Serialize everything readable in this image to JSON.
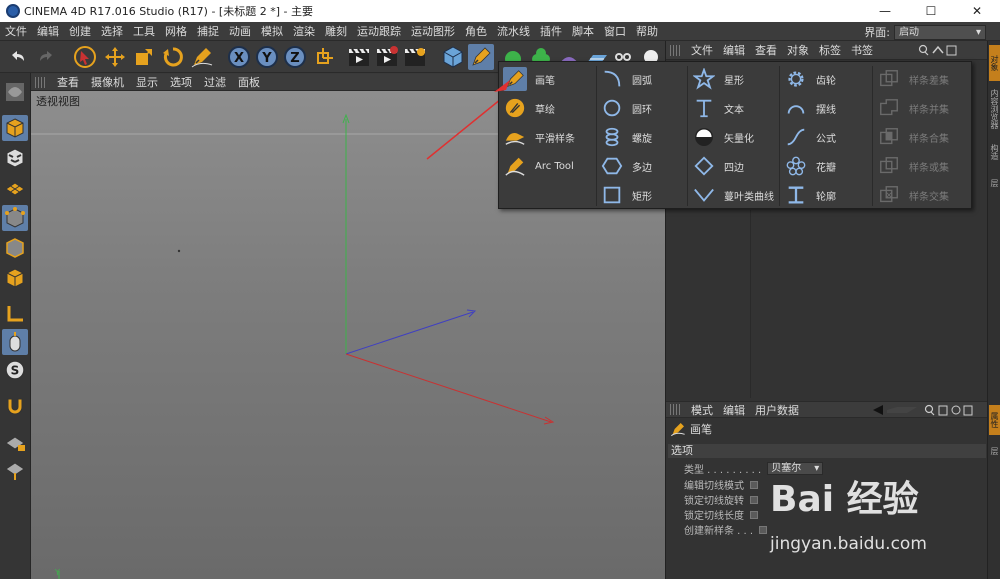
{
  "window": {
    "title": "CINEMA 4D R17.016 Studio (R17) - [未标题 2 *] - 主要",
    "minimize": "—",
    "maximize": "☐",
    "close": "✕"
  },
  "menubar": {
    "items": [
      "文件",
      "编辑",
      "创建",
      "选择",
      "工具",
      "网格",
      "捕捉",
      "动画",
      "模拟",
      "渲染",
      "雕刻",
      "运动跟踪",
      "运动图形",
      "角色",
      "流水线",
      "插件",
      "脚本",
      "窗口",
      "帮助"
    ],
    "layout_label": "界面:",
    "layout_value": "启动"
  },
  "viewport": {
    "menu": [
      "查看",
      "摄像机",
      "显示",
      "选项",
      "过滤",
      "面板"
    ],
    "label": "透视视图",
    "axis_y_label": "Y"
  },
  "object_manager": {
    "menu": [
      "文件",
      "编辑",
      "查看",
      "对象",
      "标签",
      "书签"
    ]
  },
  "attributes": {
    "menu": [
      "模式",
      "编辑",
      "用户数据"
    ],
    "title": "画笔",
    "section": "选项",
    "rows": [
      {
        "label": "类型 . . . . . . . . .",
        "value": "贝塞尔"
      },
      {
        "label": "编辑切线模式"
      },
      {
        "label": "锁定切线旋转"
      },
      {
        "label": "锁定切线长度"
      },
      {
        "label": "创建新样条 . . ."
      }
    ]
  },
  "side_tabs": [
    "对象",
    "内容浏览器",
    "构造",
    "层"
  ],
  "side_tabs_lower": [
    "属性",
    "层"
  ],
  "spline_menu": {
    "col1": [
      "画笔",
      "草绘",
      "平滑样条",
      "Arc Tool"
    ],
    "col2": [
      "圆弧",
      "圆环",
      "螺旋",
      "多边",
      "矩形"
    ],
    "col3": [
      "星形",
      "文本",
      "矢量化",
      "四边",
      "蔓叶类曲线"
    ],
    "col4": [
      "齿轮",
      "摆线",
      "公式",
      "花瓣",
      "轮廓"
    ],
    "col5": [
      "样条差集",
      "样条并集",
      "样条合集",
      "样条或集",
      "样条交集"
    ],
    "highlighted": "画笔"
  },
  "colors": {
    "highlight": "#5f7fa8",
    "accent_orange": "#e6a21e",
    "axis_green": "#3db34a",
    "axis_red": "#c83232",
    "axis_blue": "#4040c0",
    "arrow_red": "#e03030"
  },
  "watermark": {
    "logo": "Bai 经验",
    "url": "jingyan.baidu.com"
  }
}
